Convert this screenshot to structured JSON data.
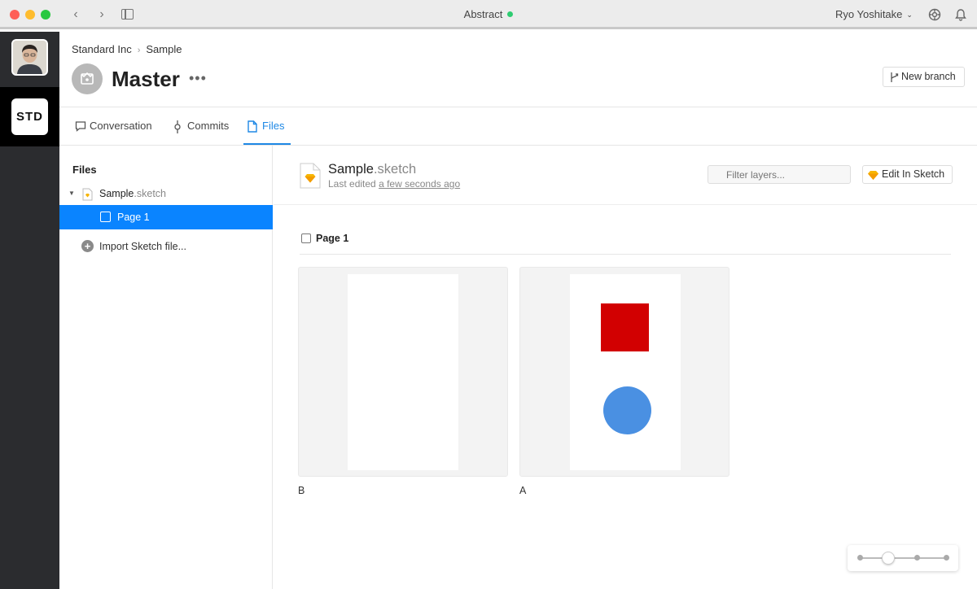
{
  "window": {
    "app_title": "Abstract",
    "user_name": "Ryo Yoshitake"
  },
  "rail": {
    "org_logo": "STD",
    "icons": [
      "avatar-photo",
      "org-logo"
    ]
  },
  "header": {
    "breadcrumb": [
      "Standard Inc",
      "Sample"
    ],
    "title": "Master",
    "more": "•••",
    "new_branch": "New branch"
  },
  "tabs": [
    {
      "label": "Conversation",
      "icon": "chat-bubble-icon"
    },
    {
      "label": "Commits",
      "icon": "commit-icon"
    },
    {
      "label": "Files",
      "icon": "file-icon",
      "active": true
    }
  ],
  "files_sidebar": {
    "heading": "Files",
    "file_name": "Sample",
    "file_ext": ".sketch",
    "page_name": "Page 1",
    "import_label": "Import Sketch file..."
  },
  "file": {
    "name": "Sample",
    "ext": ".sketch",
    "last_edited_prefix": "Last edited",
    "last_edited_link": "a few seconds ago",
    "filter_placeholder": "Filter layers...",
    "edit_button": "Edit In Sketch"
  },
  "page": {
    "label": "Page 1",
    "artboards": [
      {
        "name": "B"
      },
      {
        "name": "A",
        "shapes": [
          "red-square",
          "blue-circle"
        ]
      }
    ]
  },
  "zoom": {
    "level_fraction": 0.33
  },
  "colors": {
    "accent": "#1e88e5",
    "selection": "#0a84ff",
    "rail": "#2b2c2f",
    "red_shape": "#d20001",
    "blue_shape": "#4a90e2",
    "online": "#2ecc71"
  }
}
